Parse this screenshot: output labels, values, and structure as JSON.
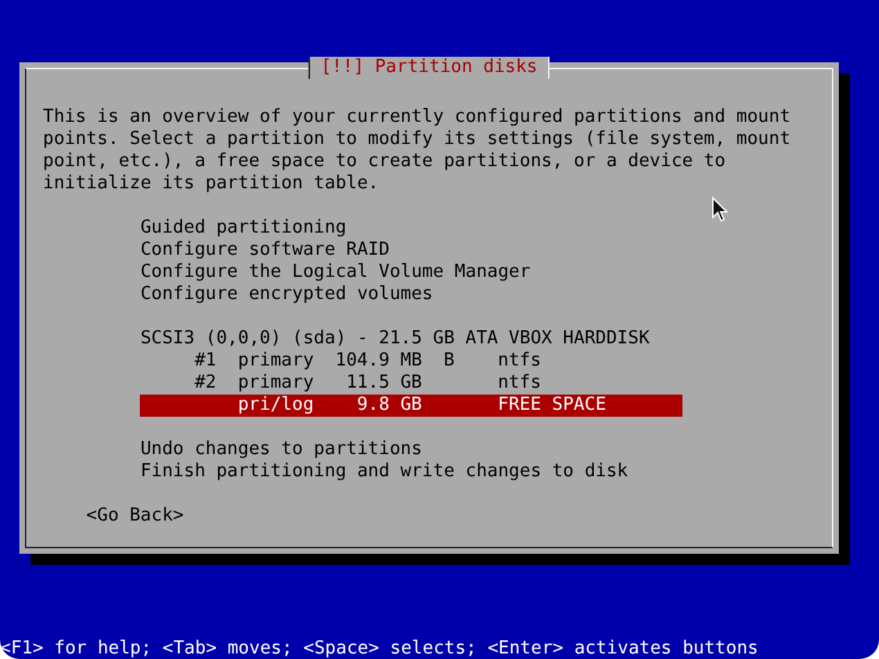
{
  "dialog": {
    "title": "[!!] Partition disks",
    "description": "This is an overview of your currently configured partitions and mount points. Select a partition to modify its settings (file system, mount point, etc.), a free space to create partitions, or a device to initialize its partition table.",
    "menu": [
      [
        {
          "kind": "option",
          "label": "Guided partitioning",
          "selected": false
        },
        {
          "kind": "option",
          "label": "Configure software RAID",
          "selected": false
        },
        {
          "kind": "option",
          "label": "Configure the Logical Volume Manager",
          "selected": false
        },
        {
          "kind": "option",
          "label": "Configure encrypted volumes",
          "selected": false
        }
      ],
      [
        {
          "kind": "disk",
          "label": "SCSI3 (0,0,0) (sda) - 21.5 GB ATA VBOX HARDDISK",
          "selected": false
        },
        {
          "kind": "partition",
          "number": "#1",
          "type": "primary",
          "size": "104.9 MB",
          "flag": "B",
          "filesystem": "ntfs",
          "selected": false
        },
        {
          "kind": "partition",
          "number": "#2",
          "type": "primary",
          "size": "11.5 GB",
          "filesystem": "ntfs",
          "selected": false
        },
        {
          "kind": "partition",
          "type": "pri/log",
          "size": "9.8 GB",
          "filesystem": "FREE SPACE",
          "selected": true
        }
      ],
      [
        {
          "kind": "option",
          "label": "Undo changes to partitions",
          "selected": false
        },
        {
          "kind": "option",
          "label": "Finish partitioning and write changes to disk",
          "selected": false
        }
      ]
    ],
    "buttons": [
      "<Go Back>"
    ]
  },
  "status_bar": "<F1> for help; <Tab> moves; <Space> selects; <Enter> activates buttons"
}
